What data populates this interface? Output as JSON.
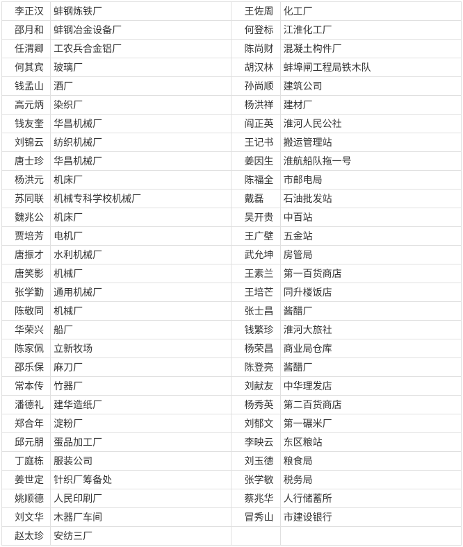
{
  "rows": [
    {
      "n1": "李正汉",
      "o1": "蚌钢炼铁厂",
      "n2": "王佐周",
      "o2": "化工厂"
    },
    {
      "n1": "邵月和",
      "o1": "蚌钢冶金设备厂",
      "n2": "何登标",
      "o2": "江淮化工厂"
    },
    {
      "n1": "任渭卿",
      "o1": "工农兵合金铝厂",
      "n2": "陈尚财",
      "o2": "混凝土构件厂"
    },
    {
      "n1": "何其宾",
      "o1": "玻璃厂",
      "n2": "胡汉林",
      "o2": "蚌埠闸工程局铁木队"
    },
    {
      "n1": "钱孟山",
      "o1": "酒厂",
      "n2": "孙尚顺",
      "o2": "建筑公司"
    },
    {
      "n1": "高元炳",
      "o1": "染织厂",
      "n2": "杨洪祥",
      "o2": "建材厂"
    },
    {
      "n1": "钱友奎",
      "o1": "华昌机械厂",
      "n2": "阎正英",
      "o2": "淮河人民公社"
    },
    {
      "n1": "刘锦云",
      "o1": "纺织机械厂",
      "n2": "王记书",
      "o2": "搬运管理站"
    },
    {
      "n1": "唐士珍",
      "o1": "华昌机械厂",
      "n2": "姜因生",
      "o2": "淮航船队拖一号"
    },
    {
      "n1": "杨洪元",
      "o1": "机床厂",
      "n2": "陈福全",
      "o2": "市邮电局"
    },
    {
      "n1": "苏同联",
      "o1": "机械专科学校机械厂",
      "n2": "戴磊",
      "o2": "石油批发站"
    },
    {
      "n1": "魏兆公",
      "o1": "机床厂",
      "n2": "吴开贵",
      "o2": "中百站"
    },
    {
      "n1": "贾培芳",
      "o1": "电机厂",
      "n2": "王广壁",
      "o2": "五金站"
    },
    {
      "n1": "唐振才",
      "o1": "水利机械厂",
      "n2": "武允坤",
      "o2": "房管局"
    },
    {
      "n1": "唐笑影",
      "o1": "机械厂",
      "n2": "王素兰",
      "o2": "第一百货商店"
    },
    {
      "n1": "张学勤",
      "o1": "通用机械厂",
      "n2": "王培芒",
      "o2": "同升楼饭店"
    },
    {
      "n1": "陈敬同",
      "o1": "机械厂",
      "n2": "张士昌",
      "o2": "酱醋厂"
    },
    {
      "n1": "华荣兴",
      "o1": "船厂",
      "n2": "钱繁珍",
      "o2": "淮河大旅社"
    },
    {
      "n1": "陈家佩",
      "o1": "立新牧场",
      "n2": "杨荣昌",
      "o2": "商业局仓库"
    },
    {
      "n1": "邵乐保",
      "o1": "麻刀厂",
      "n2": "陈登亮",
      "o2": "酱醋厂"
    },
    {
      "n1": "常本传",
      "o1": "竹器厂",
      "n2": "刘献友",
      "o2": "中华理发店"
    },
    {
      "n1": "潘德礼",
      "o1": "建华造纸厂",
      "n2": "杨秀英",
      "o2": "第二百货商店"
    },
    {
      "n1": "郑合年",
      "o1": "淀粉厂",
      "n2": "刘郁文",
      "o2": "第一碾米厂"
    },
    {
      "n1": "邱元朋",
      "o1": "蛋品加工厂",
      "n2": "李映云",
      "o2": "东区粮站"
    },
    {
      "n1": "丁庭栋",
      "o1": "服装公司",
      "n2": "刘玉德",
      "o2": "粮食局"
    },
    {
      "n1": "姜世定",
      "o1": "针织厂筹备处",
      "n2": "张学敏",
      "o2": "税务局"
    },
    {
      "n1": "姚顺德",
      "o1": "人民印刷厂",
      "n2": "蔡兆华",
      "o2": "人行储蓄所"
    },
    {
      "n1": "刘文华",
      "o1": "木器厂车间",
      "n2": "冒秀山",
      "o2": "市建设银行"
    },
    {
      "n1": "赵太珍",
      "o1": "安纺三厂",
      "n2": "",
      "o2": ""
    }
  ]
}
